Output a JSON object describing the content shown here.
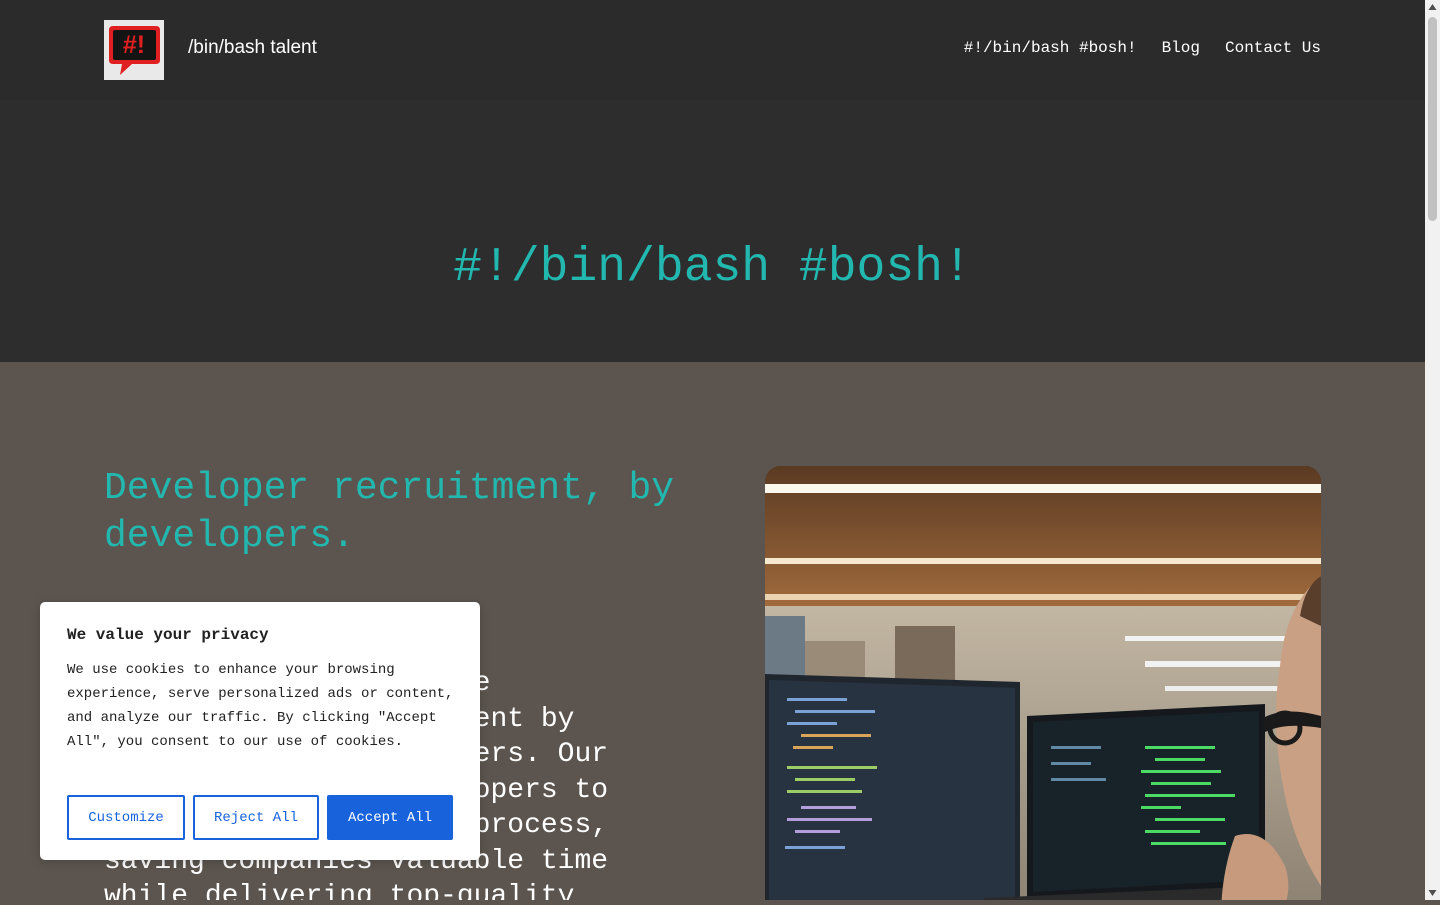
{
  "header": {
    "logo_text": "#!",
    "site_title": "/bin/bash talent",
    "nav": [
      "#!/bin/bash #bosh!",
      "Blog",
      "Contact Us"
    ]
  },
  "hero": {
    "title": "#!/bin/bash #bosh!"
  },
  "main": {
    "headline": "Developer recruitment, by developers.",
    "paragraph": "At /bin/bash talent, we specialise in recruitment by developers for developers. Our expertise allows developers to streamline the hiring process, saving companies valuable time while delivering top-quality"
  },
  "cookie_banner": {
    "title": "We value your privacy",
    "text": "We use cookies to enhance your browsing experience, serve personalized ads or content, and analyze our traffic. By clicking \"Accept All\", you consent to our use of cookies.",
    "customize_label": "Customize",
    "reject_label": "Reject All",
    "accept_label": "Accept All"
  },
  "colors": {
    "accent": "#22b8b0",
    "header_bg": "#2b2b2b",
    "section_bg": "#5c554f",
    "button_blue": "#1863dc",
    "logo_red": "#e02020"
  }
}
